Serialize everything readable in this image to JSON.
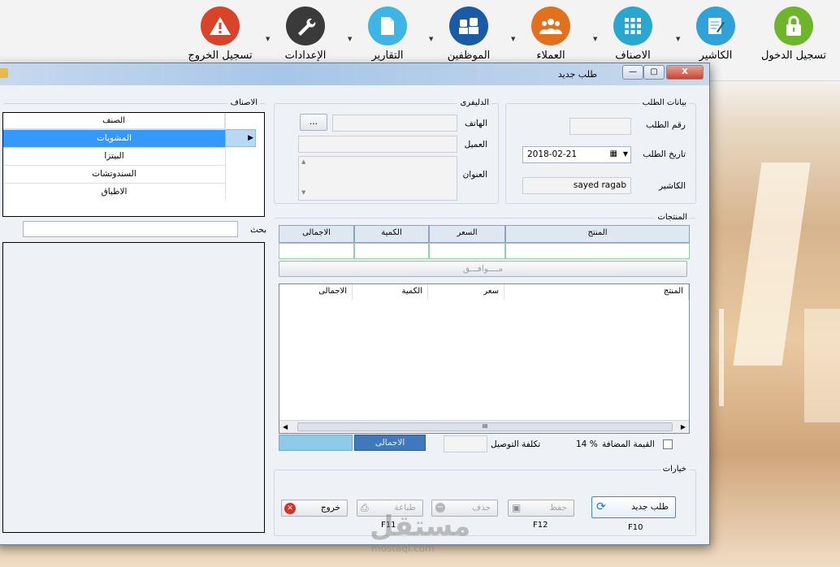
{
  "ribbon": {
    "items": [
      {
        "label": "تسجيل الدخول",
        "icon": "lock-icon",
        "color": "#6fb52c"
      },
      {
        "label": "الكاشير",
        "icon": "notepad-icon",
        "color": "#2fa3d9"
      },
      {
        "label": "الاصناف",
        "icon": "grid-icon",
        "color": "#2aa7cf"
      },
      {
        "label": "العملاء",
        "icon": "customers-icon",
        "color": "#e2711d"
      },
      {
        "label": "الموظفين",
        "icon": "employees-icon",
        "color": "#1b5aa6"
      },
      {
        "label": "التقارير",
        "icon": "document-icon",
        "color": "#3db6e5"
      },
      {
        "label": "الإعدادات",
        "icon": "wrench-icon",
        "color": "#3a3a3a"
      },
      {
        "label": "تسجيل الخروج",
        "icon": "warning-icon",
        "color": "#d9432a"
      }
    ]
  },
  "window": {
    "title": "طلب جديد",
    "btn_min": "—",
    "btn_max": "▢",
    "btn_close": "X"
  },
  "order_info": {
    "legend": "بيانات الطلب",
    "order_no_label": "رقم الطلب",
    "order_no_value": "",
    "date_label": "تاريخ الطلب",
    "date_value": "2018-02-21",
    "cashier_label": "الكاشير",
    "cashier_value": "sayed ragab"
  },
  "delivery": {
    "legend": "الدليفرى",
    "phone_label": "الهاتف",
    "phone_value": "",
    "lookup_button": "...",
    "customer_label": "العميل",
    "customer_value": "",
    "address_label": "العنوان",
    "address_value": ""
  },
  "products": {
    "legend": "المنتجات",
    "entry_headers": [
      "المنتج",
      "السعر",
      "الكمية",
      "الاجمالى"
    ],
    "ok_button": "مــــوافـــق",
    "list_headers": [
      "المنتج",
      "سعر",
      "الكمية",
      "الاجمالى"
    ],
    "scroll_grip": "III"
  },
  "totals": {
    "vat_label": "القيمة المضافة",
    "vat_value": "14 %",
    "delivery_cost_label": "تكلفة التوصيل",
    "delivery_cost_value": "",
    "total_button": "الاجمالى",
    "total_value": ""
  },
  "options": {
    "legend": "خيارات",
    "new_order": "طلب جديد",
    "new_order_key": "F10",
    "save": "حفظ",
    "save_key": "F12",
    "delete": "حذف",
    "print": "طباعة",
    "print_key": "F11",
    "exit": "خروج"
  },
  "categories": {
    "legend": "الاصناف",
    "header": "الصنف",
    "rows": [
      "المشويات",
      "البيتزا",
      "السندوتشات",
      "الاطباق"
    ],
    "selected_index": 0,
    "search_label": "بحث",
    "search_value": ""
  },
  "watermark": {
    "text": "مستقل",
    "subtext": "mostaql.com"
  }
}
